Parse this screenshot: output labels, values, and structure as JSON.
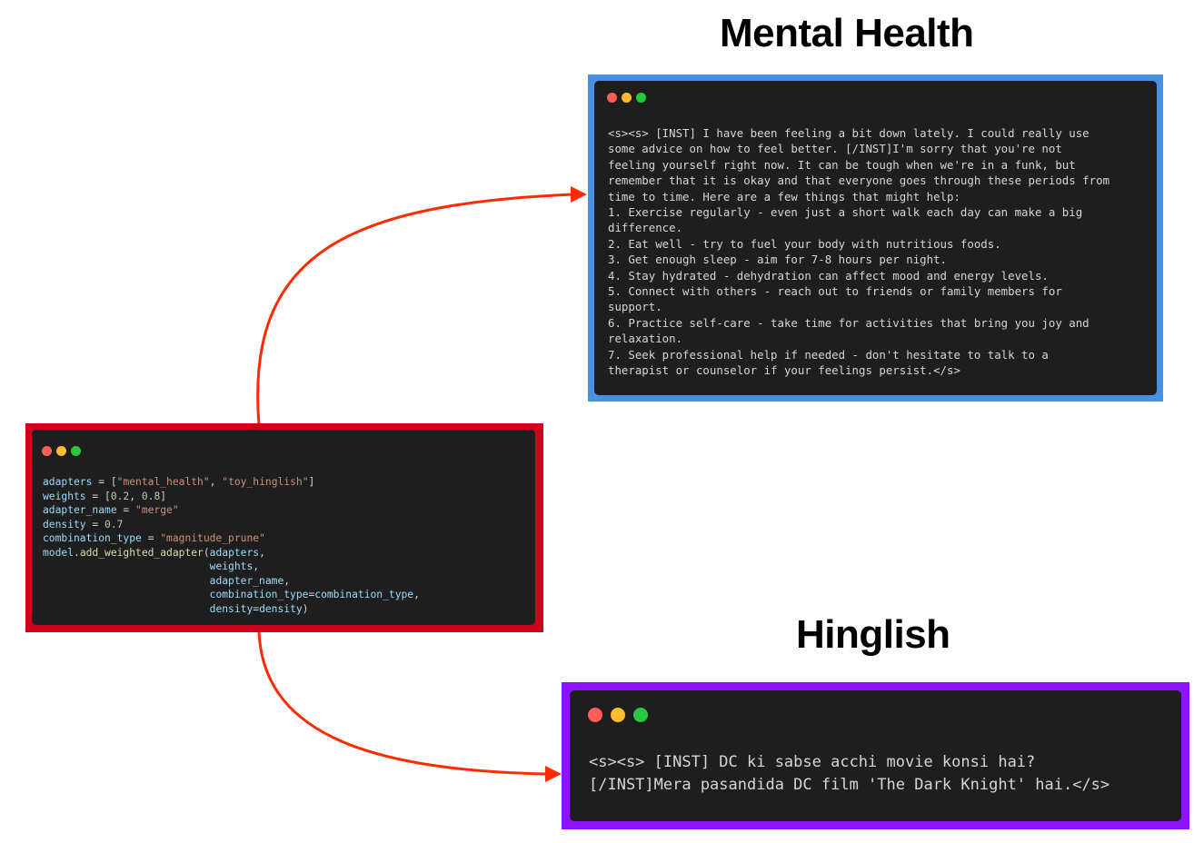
{
  "titles": {
    "top": "Mental Health",
    "bottom": "Hinglish"
  },
  "colors": {
    "code_frame": "#d0021b",
    "mental_health_frame": "#4a90e2",
    "hinglish_frame": "#9013fe",
    "arrow": "#ff2a00",
    "window_bg": "#1e1e1e",
    "dot_red": "#ff5f57",
    "dot_yellow": "#febc2e",
    "dot_green": "#28c840"
  },
  "code_window": {
    "lines": [
      [
        {
          "t": "adapters",
          "c": "v"
        },
        {
          "t": " = [",
          "c": "o"
        },
        {
          "t": "\"mental_health\"",
          "c": "s"
        },
        {
          "t": ", ",
          "c": "o"
        },
        {
          "t": "\"toy_hinglish\"",
          "c": "s"
        },
        {
          "t": "]",
          "c": "o"
        }
      ],
      [
        {
          "t": "weights",
          "c": "v"
        },
        {
          "t": " = [",
          "c": "o"
        },
        {
          "t": "0.2",
          "c": "n"
        },
        {
          "t": ", ",
          "c": "o"
        },
        {
          "t": "0.8",
          "c": "n"
        },
        {
          "t": "]",
          "c": "o"
        }
      ],
      [
        {
          "t": "adapter_name",
          "c": "v"
        },
        {
          "t": " = ",
          "c": "o"
        },
        {
          "t": "\"merge\"",
          "c": "s"
        }
      ],
      [
        {
          "t": "density",
          "c": "v"
        },
        {
          "t": " = ",
          "c": "o"
        },
        {
          "t": "0.7",
          "c": "n"
        }
      ],
      [
        {
          "t": "combination_type",
          "c": "v"
        },
        {
          "t": " = ",
          "c": "o"
        },
        {
          "t": "\"magnitude_prune\"",
          "c": "s"
        }
      ],
      [
        {
          "t": "model",
          "c": "v"
        },
        {
          "t": ".",
          "c": "o"
        },
        {
          "t": "add_weighted_adapter",
          "c": "f"
        },
        {
          "t": "(",
          "c": "o"
        },
        {
          "t": "adapters",
          "c": "v"
        },
        {
          "t": ",",
          "c": "o"
        }
      ],
      [
        {
          "t": "                           ",
          "c": "o"
        },
        {
          "t": "weights",
          "c": "v"
        },
        {
          "t": ",",
          "c": "o"
        }
      ],
      [
        {
          "t": "                           ",
          "c": "o"
        },
        {
          "t": "adapter_name",
          "c": "v"
        },
        {
          "t": ",",
          "c": "o"
        }
      ],
      [
        {
          "t": "                           ",
          "c": "o"
        },
        {
          "t": "combination_type",
          "c": "v"
        },
        {
          "t": "=",
          "c": "o"
        },
        {
          "t": "combination_type",
          "c": "v"
        },
        {
          "t": ",",
          "c": "o"
        }
      ],
      [
        {
          "t": "                           ",
          "c": "o"
        },
        {
          "t": "density",
          "c": "v"
        },
        {
          "t": "=",
          "c": "o"
        },
        {
          "t": "density",
          "c": "v"
        },
        {
          "t": ")",
          "c": "o"
        }
      ]
    ]
  },
  "mental_health_window": {
    "lines": [
      "<s><s> [INST] I have been feeling a bit down lately. I could really use",
      "some advice on how to feel better. [/INST]I'm sorry that you're not",
      "feeling yourself right now. It can be tough when we're in a funk, but",
      "remember that it is okay and that everyone goes through these periods from",
      "time to time. Here are a few things that might help:",
      "1. Exercise regularly - even just a short walk each day can make a big",
      "difference.",
      "2. Eat well - try to fuel your body with nutritious foods.",
      "3. Get enough sleep - aim for 7-8 hours per night.",
      "4. Stay hydrated - dehydration can affect mood and energy levels.",
      "5. Connect with others - reach out to friends or family members for",
      "support.",
      "6. Practice self-care - take time for activities that bring you joy and",
      "relaxation.",
      "7. Seek professional help if needed - don't hesitate to talk to a",
      "therapist or counselor if your feelings persist.</s>"
    ]
  },
  "hinglish_window": {
    "lines": [
      "<s><s> [INST] DC ki sabse acchi movie konsi hai?",
      "[/INST]Mera pasandida DC film 'The Dark Knight' hai.</s>"
    ]
  }
}
